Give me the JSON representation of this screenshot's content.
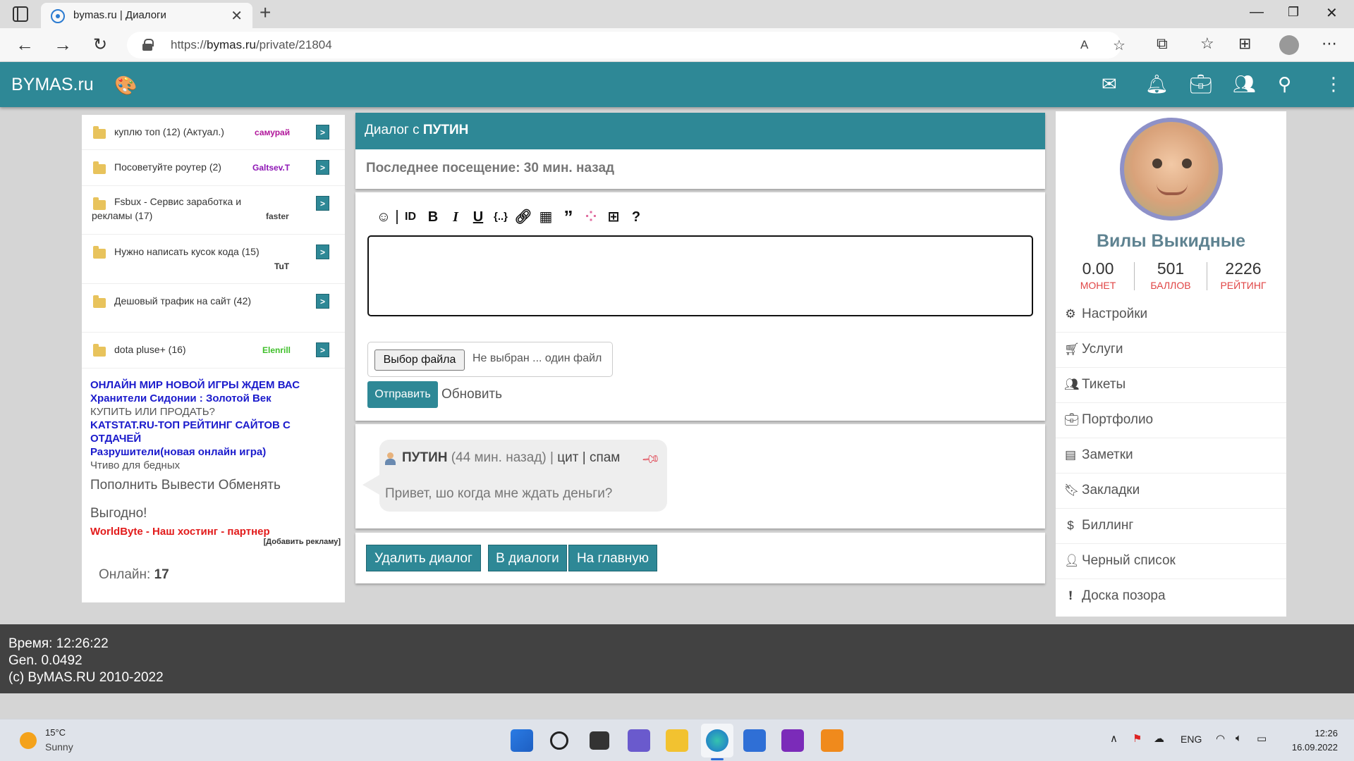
{
  "browser": {
    "tab_title": "bymas.ru | Диалоги",
    "url_prefix": "https://",
    "url_host": "bymas.ru",
    "url_path": "/private/21804"
  },
  "site": {
    "logo": "BYMAS.ru"
  },
  "topics": [
    {
      "title": "куплю топ (12) (Актуал.)",
      "author": "самурай",
      "author_color": "#b0159a",
      "go": ">"
    },
    {
      "title": "Посоветуйте роутер (2)",
      "author": "Galtsev.T",
      "author_color": "#8e16b5",
      "go": ">"
    },
    {
      "title": "Fsbux - Сервис заработка и рекламы (17)",
      "author": "faster",
      "author_color": "#444444",
      "go": ">"
    },
    {
      "title": "Нужно написать кусок кода (15)",
      "author": "TuT",
      "author_color": "#333333",
      "go": ">"
    },
    {
      "title": "Дешовый трафик на сайт (42)",
      "author": "",
      "author_color": "#333333",
      "go": ">"
    },
    {
      "title": "dota pluse+ (16)",
      "author": "Elenrill",
      "author_color": "#3fbf2a",
      "go": ">"
    }
  ],
  "ads": {
    "line1": "ОНЛАЙН МИР НОВОЙ ИГРЫ ЖДЕМ ВАС",
    "line2": "Хранители Сидонии : Золотой Век",
    "line3": "КУПИТЬ ИЛИ ПРОДАТЬ?",
    "line4": "KATSTAT.RU-ТОП РЕЙТИНГ САЙТОВ С ОТДАЧЕЙ",
    "line5": "Разрушители(новая онлайн игра)",
    "line6": "Чтиво для бедных",
    "line7": "Пополнить Вывести Обменять",
    "line8": "Выгодно!",
    "line9": "WorldByte - Наш хостинг - партнер",
    "add_ad": "[Добавить рекламу]"
  },
  "online": {
    "label": "Онлайн:",
    "count": "17"
  },
  "dialog": {
    "title_prefix": "Диалог с",
    "partner": "ПУТИН",
    "last_seen": "Последнее посещение: 30 мин. назад",
    "file_button": "Выбор файла",
    "file_none": "Не выбран ... один файл",
    "send": "Отправить",
    "refresh": "Обновить"
  },
  "message": {
    "author": "ПУТИН",
    "time": "(44 мин. назад) |",
    "quote": "цит",
    "sep": "|",
    "spam": "спам",
    "text": "Привет, шо когда мне ждать деньги?"
  },
  "actions": {
    "delete": "Удалить диалог",
    "to_dialogs": "В диалоги",
    "home": "На главную"
  },
  "profile": {
    "name": "Вилы Выкидные",
    "coins": "0.00",
    "coins_label": "МОНЕТ",
    "points": "501",
    "points_label": "БАЛЛОВ",
    "rating": "2226",
    "rating_label": "РЕЙТИНГ"
  },
  "menu": [
    {
      "label": "Настройки",
      "icon": "gear-icon"
    },
    {
      "label": "Услуги",
      "icon": "cart-icon"
    },
    {
      "label": "Тикеты",
      "icon": "people-icon"
    },
    {
      "label": "Портфолио",
      "icon": "briefcase-icon"
    },
    {
      "label": "Заметки",
      "icon": "calendar-icon"
    },
    {
      "label": "Закладки",
      "icon": "bookmark-icon"
    },
    {
      "label": "Биллинг",
      "icon": "dollar-icon"
    },
    {
      "label": "Черный список",
      "icon": "person-icon"
    },
    {
      "label": "Доска позора",
      "icon": "alert-icon"
    }
  ],
  "footer": {
    "time": "Время: 12:26:22",
    "gen": "Gen. 0.0492",
    "copyright": "(c) ByMAS.RU 2010-2022"
  },
  "taskbar": {
    "temp": "15°C",
    "weather": "Sunny",
    "lang": "ENG",
    "time": "12:26",
    "date": "16.09.2022"
  },
  "colors": {
    "accent": "#2e8896",
    "danger": "#e04545",
    "ad_blue": "#1a1acc",
    "ad_red": "#e21b1b"
  }
}
